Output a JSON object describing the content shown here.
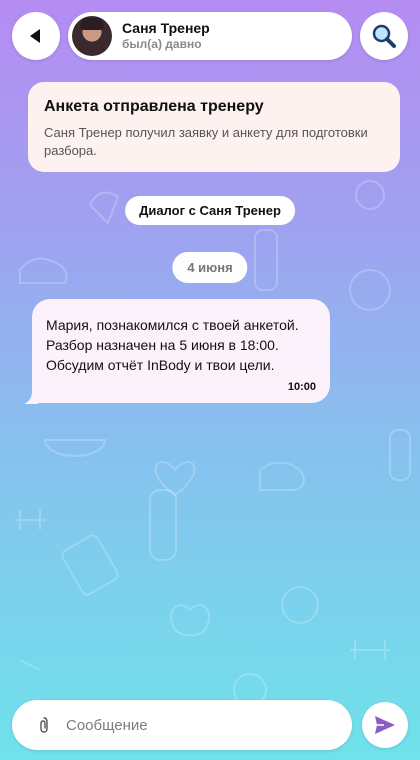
{
  "header": {
    "name": "Саня Тренер",
    "status": "был(а) давно"
  },
  "notice": {
    "title": "Анкета отправлена тренеру",
    "text": "Саня Тренер получил заявку и анкету для подготовки разбора."
  },
  "dialog_label": "Диалог с Саня Тренер",
  "date_label": "4 июня",
  "message": {
    "line1": "Мария, познакомился с твоей анкетой.",
    "line2": "Разбор назначен на 5 июня в 18:00.",
    "line3": "Обсудим отчёт InBody и твои цели.",
    "time": "10:00"
  },
  "composer": {
    "placeholder": "Сообщение"
  },
  "colors": {
    "gradient_top": "#b58cf2",
    "gradient_bottom": "#6fe2ea",
    "send_icon": "#8b5cc7"
  },
  "icons": [
    "back-icon",
    "search-icon",
    "attach-icon",
    "send-icon"
  ]
}
